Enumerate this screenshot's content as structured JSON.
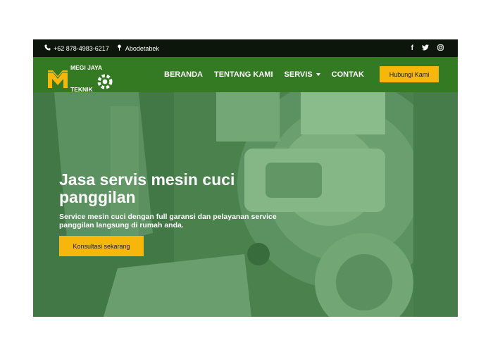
{
  "topbar": {
    "phone_icon": "phone-icon",
    "phone": "+62 878-4983-6217",
    "location_icon": "map-pin-icon",
    "location": "Abodetabek",
    "social": {
      "facebook": "f",
      "twitter_icon": "twitter-icon",
      "instagram_icon": "instagram-icon"
    }
  },
  "nav": {
    "logo_icon": "megi-jaya-logo-icon",
    "brand_line1": "MEGI JAYA",
    "brand_line2": "TEKNIK",
    "gear_icon": "gear-icon",
    "menu": [
      "BERANDA",
      "TENTANG KAMI",
      "SERVIS",
      "CONTAK"
    ],
    "dropdown_icon": "caret-down-icon",
    "cta_label": "Hubungi Kami"
  },
  "hero": {
    "title": "Jasa servis mesin cuci panggilan",
    "subtitle": "Service mesin cuci dengan full garansi dan pelayanan service panggilan langsung di rumah anda.",
    "button_label": "Konsultasi sekarang"
  },
  "colors": {
    "topbar_bg": "#0d160b",
    "nav_bg": "#347a23",
    "accent": "#f6b60b",
    "hero_overlay": "#349632"
  }
}
